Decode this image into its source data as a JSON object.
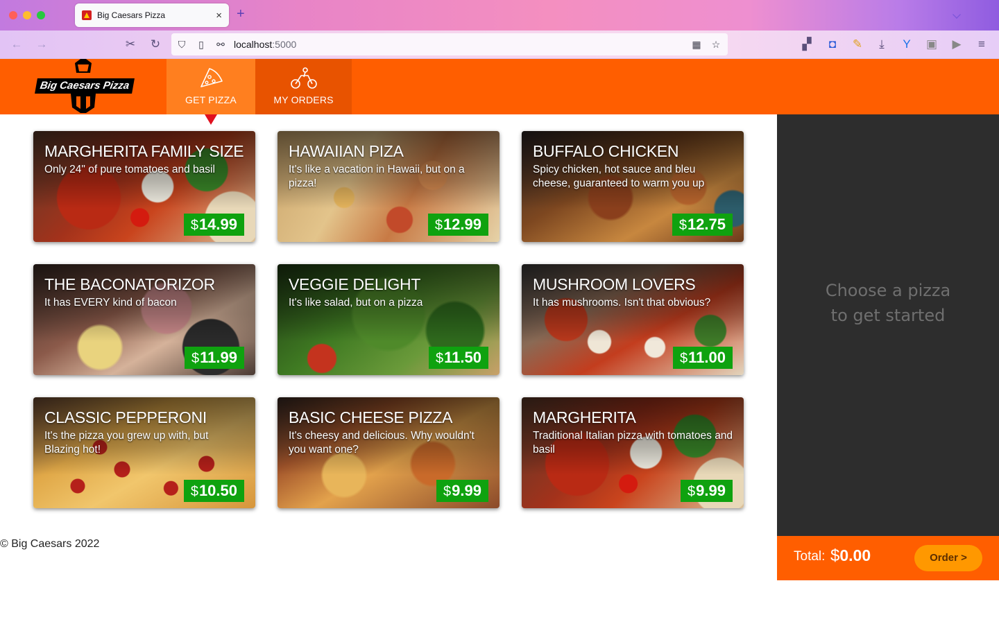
{
  "browser": {
    "tab_title": "Big Caesars Pizza",
    "tab_close": "×",
    "new_tab": "+",
    "url_host": "localhost",
    "url_port": ":5000"
  },
  "header": {
    "logo_text": "Big Caesars Pizza",
    "nav": [
      {
        "label": "GET PIZZA",
        "active": true,
        "icon": "pizza-slice-icon"
      },
      {
        "label": "MY ORDERS",
        "active": false,
        "icon": "delivery-scooter-icon"
      }
    ]
  },
  "pizzas": [
    {
      "name": "MARGHERITA FAMILY SIZE",
      "description": "Only 24\" of pure tomatoes and basil",
      "currency": "$",
      "price": "14.99"
    },
    {
      "name": "HAWAIIAN PIZA",
      "description": "It's like a vacation in Hawaii, but on a pizza!",
      "currency": "$",
      "price": "12.99"
    },
    {
      "name": "BUFFALO CHICKEN",
      "description": "Spicy chicken, hot sauce and bleu cheese, guaranteed to warm you up",
      "currency": "$",
      "price": "12.75"
    },
    {
      "name": "THE BACONATORIZOR",
      "description": "It has EVERY kind of bacon",
      "currency": "$",
      "price": "11.99"
    },
    {
      "name": "VEGGIE DELIGHT",
      "description": "It's like salad, but on a pizza",
      "currency": "$",
      "price": "11.50"
    },
    {
      "name": "MUSHROOM LOVERS",
      "description": "It has mushrooms. Isn't that obvious?",
      "currency": "$",
      "price": "11.00"
    },
    {
      "name": "CLASSIC PEPPERONI",
      "description": "It's the pizza you grew up with, but Blazing hot!",
      "currency": "$",
      "price": "10.50"
    },
    {
      "name": "BASIC CHEESE PIZZA",
      "description": "It's cheesy and delicious. Why wouldn't you want one?",
      "currency": "$",
      "price": "9.99"
    },
    {
      "name": "MARGHERITA",
      "description": "Traditional Italian pizza with tomatoes and basil",
      "currency": "$",
      "price": "9.99"
    }
  ],
  "order": {
    "empty_line1": "Choose a pizza",
    "empty_line2": "to get started",
    "total_label": "Total:",
    "total_currency": "$",
    "total_value": "0.00",
    "order_button": "Order >"
  },
  "footer": {
    "copyright": "© Big Caesars 2022"
  },
  "colors": {
    "brand_orange": "#ff5e00",
    "price_green": "#0fa20f",
    "sidebar_dark": "#2d2d2d",
    "order_button": "#ff9800"
  }
}
